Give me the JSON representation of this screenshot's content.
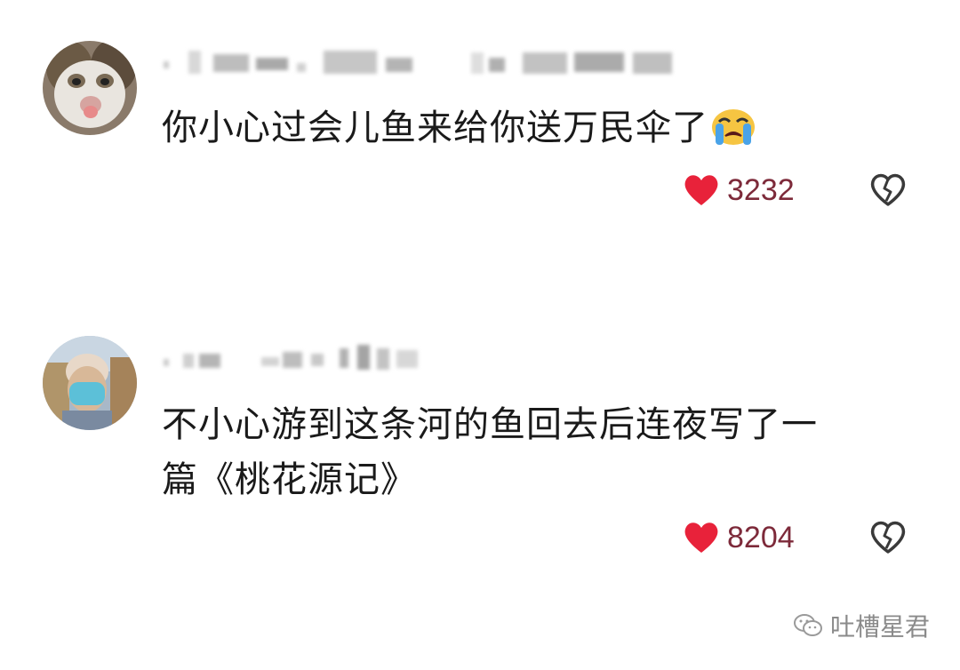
{
  "comments": [
    {
      "text": "你小心过会儿鱼来给你送万民伞了",
      "emoji": "crying-face",
      "likes": "3232",
      "liked": true
    },
    {
      "text_line1": "不小心游到这条河的鱼回去后连夜写了一",
      "text_line2": "篇《桃花源记》",
      "likes": "8204",
      "liked": true
    }
  ],
  "watermark": {
    "text": "吐槽星君"
  },
  "colors": {
    "heart": "#e8223a",
    "like_count": "#7d2a3a",
    "text": "#1a1a1a",
    "muted": "#8a8a8a"
  }
}
